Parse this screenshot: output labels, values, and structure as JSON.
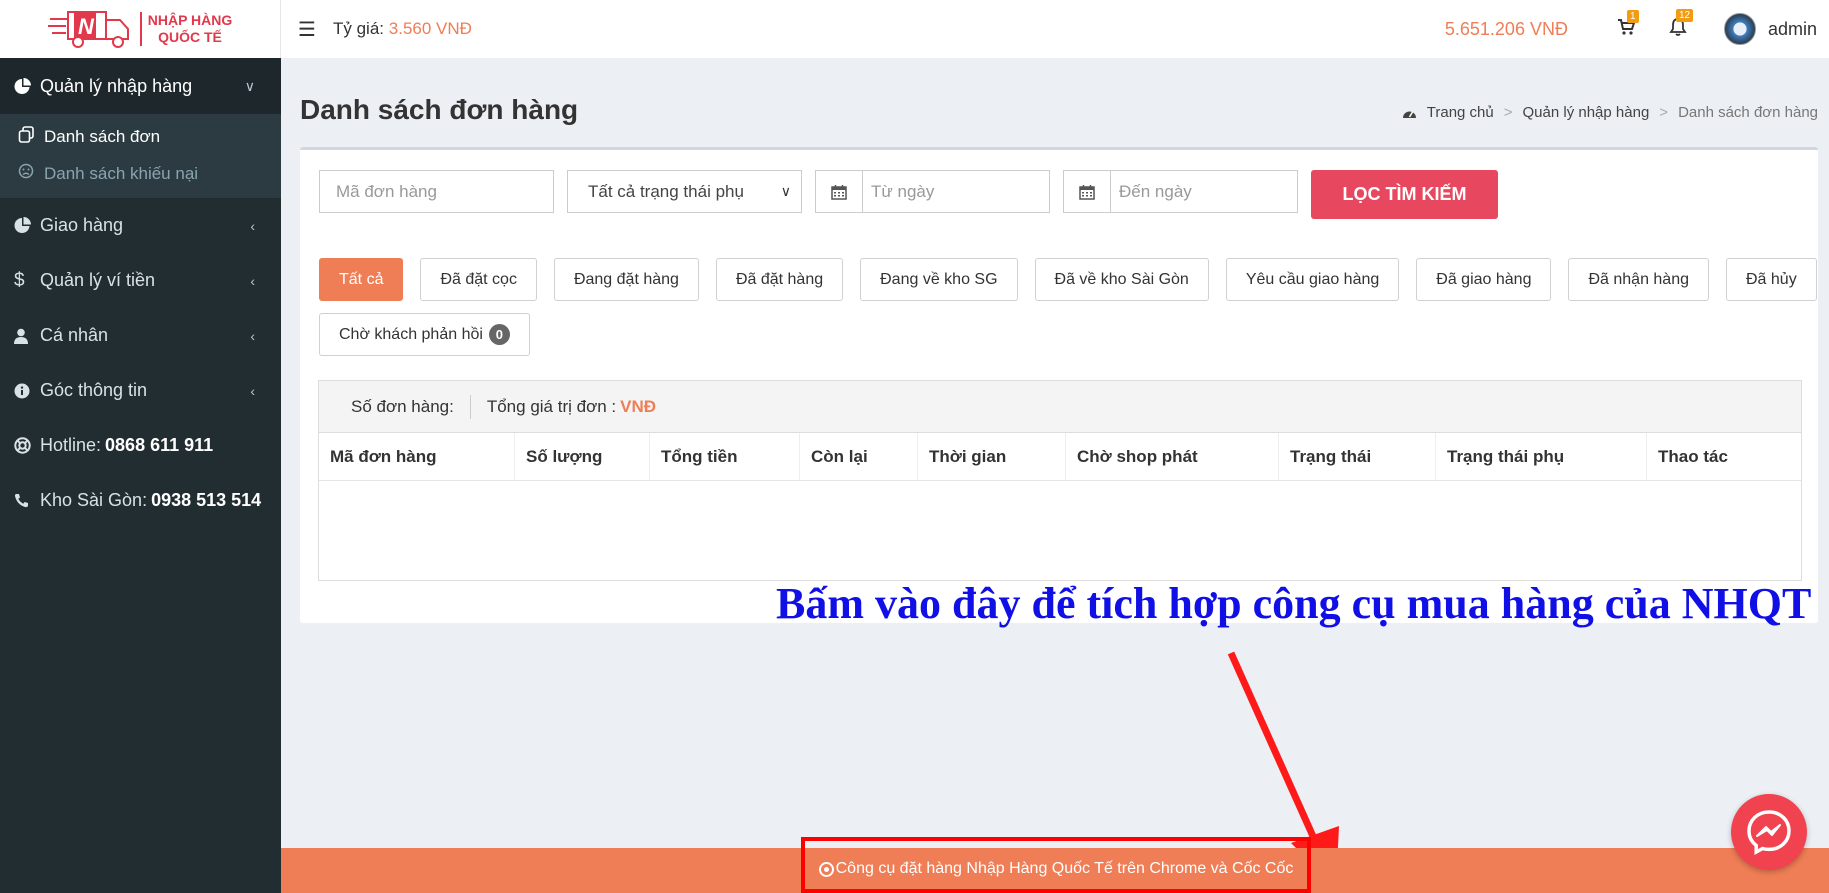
{
  "header": {
    "logo_line1": "NHẬP HÀNG",
    "logo_line2": "QUỐC TẾ",
    "rate_label": "Tỷ giá:",
    "rate_value": "3.560 VNĐ",
    "balance": "5.651.206 VNĐ",
    "cart_count": "1",
    "notif_count": "12",
    "username": "admin"
  },
  "sidebar": {
    "items": [
      {
        "label": "Quản lý nhập hàng",
        "icon": "pie-chart-icon"
      },
      {
        "label": "Giao hàng",
        "icon": "pie-chart-icon"
      },
      {
        "label": "Quản lý ví tiền",
        "icon": "dollar-icon"
      },
      {
        "label": "Cá nhân",
        "icon": "user-icon"
      },
      {
        "label": "Góc thông tin",
        "icon": "info-icon"
      }
    ],
    "sub_items": [
      {
        "label": "Danh sách đơn"
      },
      {
        "label": "Danh sách khiếu nại"
      }
    ],
    "hotline_label": "Hotline:",
    "hotline_number": "0868 611 911",
    "warehouse_label": "Kho Sài Gòn:",
    "warehouse_number": "0938 513 514"
  },
  "page": {
    "title": "Danh sách đơn hàng",
    "breadcrumb": [
      "Trang chủ",
      "Quản lý nhập hàng",
      "Danh sách đơn hàng"
    ]
  },
  "filters": {
    "code_placeholder": "Mã đơn hàng",
    "status_selected": "Tất cả trạng thái phụ",
    "from_placeholder": "Từ ngày",
    "to_placeholder": "Đến ngày",
    "search_label": "LỌC TÌM KIẾM"
  },
  "tabs": [
    {
      "label": "Tất cả"
    },
    {
      "label": "Đã đặt cọc"
    },
    {
      "label": "Đang đặt hàng"
    },
    {
      "label": "Đã đặt hàng"
    },
    {
      "label": "Đang về kho SG"
    },
    {
      "label": "Đã về kho Sài Gòn"
    },
    {
      "label": "Yêu cầu giao hàng"
    },
    {
      "label": "Đã giao hàng"
    },
    {
      "label": "Đã nhận hàng"
    },
    {
      "label": "Đã hủy"
    },
    {
      "label": "Chờ khách phản hồi",
      "count": "0"
    }
  ],
  "summary": {
    "order_count_label": "Số đơn hàng:",
    "total_label": "Tổng giá trị đơn :",
    "currency": "VNĐ"
  },
  "table": {
    "columns": [
      "Mã đơn hàng",
      "Số lượng",
      "Tổng tiền",
      "Còn lại",
      "Thời gian",
      "Chờ shop phát",
      "Trạng thái",
      "Trạng thái phụ",
      "Thao tác"
    ]
  },
  "annotation": "Bấm vào đây để tích hợp công cụ mua hàng của NHQT",
  "footer": {
    "tool_link": "Công cụ đặt hàng Nhập Hàng Quốc Tế trên Chrome và Cốc Cốc"
  },
  "colors": {
    "accent": "#ef7e56",
    "danger": "#e8485f",
    "sidebar_bg": "#222d32",
    "annotation": "#1010e6"
  }
}
